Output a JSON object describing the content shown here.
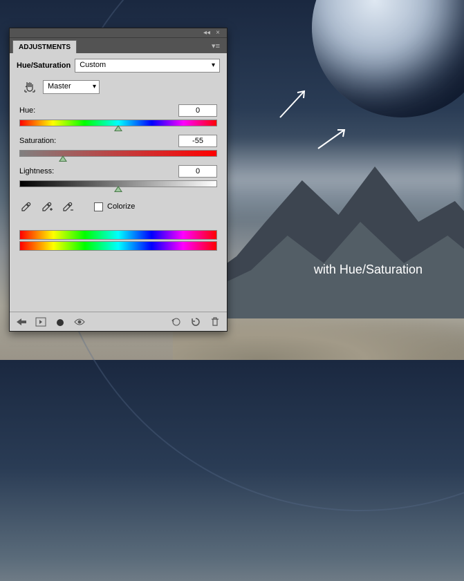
{
  "panel": {
    "tab_label": "ADJUSTMENTS",
    "title": "Hue/Saturation",
    "preset": "Custom",
    "channel": "Master",
    "sliders": {
      "hue": {
        "label": "Hue:",
        "value": "0",
        "pos_pct": 50
      },
      "saturation": {
        "label": "Saturation:",
        "value": "-55",
        "pos_pct": 22
      },
      "lightness": {
        "label": "Lightness:",
        "value": "0",
        "pos_pct": 50
      }
    },
    "colorize_label": "Colorize",
    "colorize_checked": false
  },
  "caption": "with Hue/Saturation"
}
